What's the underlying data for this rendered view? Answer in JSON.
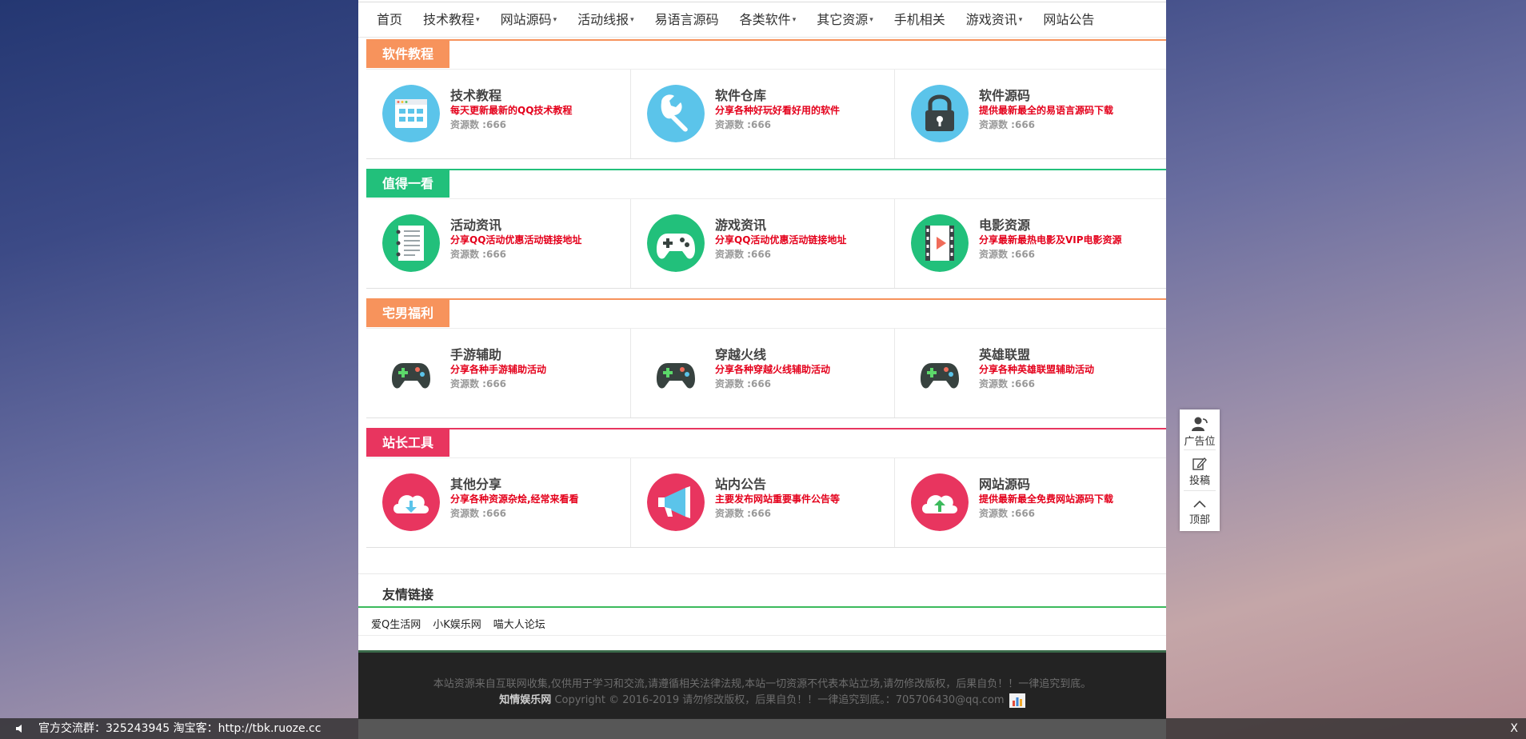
{
  "nav": {
    "items": [
      {
        "label": "首页",
        "dropdown": false
      },
      {
        "label": "技术教程",
        "dropdown": true
      },
      {
        "label": "网站源码",
        "dropdown": true
      },
      {
        "label": "活动线报",
        "dropdown": true
      },
      {
        "label": "易语言源码",
        "dropdown": false
      },
      {
        "label": "各类软件",
        "dropdown": true
      },
      {
        "label": "其它资源",
        "dropdown": true
      },
      {
        "label": "手机相关",
        "dropdown": false
      },
      {
        "label": "游戏资讯",
        "dropdown": true
      },
      {
        "label": "网站公告",
        "dropdown": false
      }
    ]
  },
  "sections": [
    {
      "title": "软件教程",
      "color": "#f7935c",
      "cards": [
        {
          "title": "技术教程",
          "desc": "每天更新最新的QQ技术教程",
          "count": "资源数 :666",
          "icon": "browser-grid-icon",
          "bg": "#5bc4ea"
        },
        {
          "title": "软件仓库",
          "desc": "分享各种好玩好看好用的软件",
          "count": "资源数 :666",
          "icon": "wrench-icon",
          "bg": "#5bc4ea"
        },
        {
          "title": "软件源码",
          "desc": "提供最新最全的易语言源码下载",
          "count": "资源数 :666",
          "icon": "lock-icon",
          "bg": "#5bc4ea"
        }
      ]
    },
    {
      "title": "值得一看",
      "color": "#22c07b",
      "cards": [
        {
          "title": "活动资讯",
          "desc": "分享QQ活动优惠活动链接地址",
          "count": "资源数 :666",
          "icon": "notepad-icon",
          "bg": "#22c07b"
        },
        {
          "title": "游戏资讯",
          "desc": "分享QQ活动优惠活动链接地址",
          "count": "资源数 :666",
          "icon": "gamepad-icon",
          "bg": "#22c07b"
        },
        {
          "title": "电影资源",
          "desc": "分享最新最热电影及VIP电影资源",
          "count": "资源数 :666",
          "icon": "film-icon",
          "bg": "#22c07b"
        }
      ]
    },
    {
      "title": "宅男福利",
      "color": "#f7935c",
      "cards": [
        {
          "title": "手游辅助",
          "desc": "分享各种手游辅助活动",
          "count": "资源数 :666",
          "icon": "gamepad-icon",
          "bg": "none"
        },
        {
          "title": "穿越火线",
          "desc": "分享各种穿越火线辅助活动",
          "count": "资源数 :666",
          "icon": "gamepad-icon",
          "bg": "none"
        },
        {
          "title": "英雄联盟",
          "desc": "分享各种英雄联盟辅助活动",
          "count": "资源数 :666",
          "icon": "gamepad-icon",
          "bg": "none"
        }
      ]
    },
    {
      "title": "站长工具",
      "color": "#e8355f",
      "cards": [
        {
          "title": "其他分享",
          "desc": "分享各种资源杂烩,经常来看看",
          "count": "资源数 :666",
          "icon": "cloud-download-icon",
          "bg": "#e8355f"
        },
        {
          "title": "站内公告",
          "desc": "主要发布网站重要事件公告等",
          "count": "资源数 :666",
          "icon": "megaphone-icon",
          "bg": "#e8355f"
        },
        {
          "title": "网站源码",
          "desc": "提供最新最全免费网站源码下载",
          "count": "资源数 :666",
          "icon": "cloud-upload-icon",
          "bg": "#e8355f"
        }
      ]
    }
  ],
  "links": {
    "title": "友情链接",
    "items": [
      "爱Q生活网",
      "小K娱乐网",
      "喵大人论坛"
    ]
  },
  "footer": {
    "line1": "本站资源来自互联网收集,仅供用于学习和交流,请遵循相关法律法规,本站一切资源不代表本站立场,请勿修改版权，后果自负！！一律追究到底。",
    "site_name": "知情娱乐网",
    "line2": " Copyright © 2016-2019 请勿修改版权，后果自负！！一律追究到底。：705706430@qq.com"
  },
  "side": {
    "ad_label": "广告位",
    "submit_label": "投稿",
    "top_label": "顶部"
  },
  "bottom_bar": {
    "text": "官方交流群：325243945 淘宝客：http://tbk.ruoze.cc",
    "close_label": "X"
  }
}
